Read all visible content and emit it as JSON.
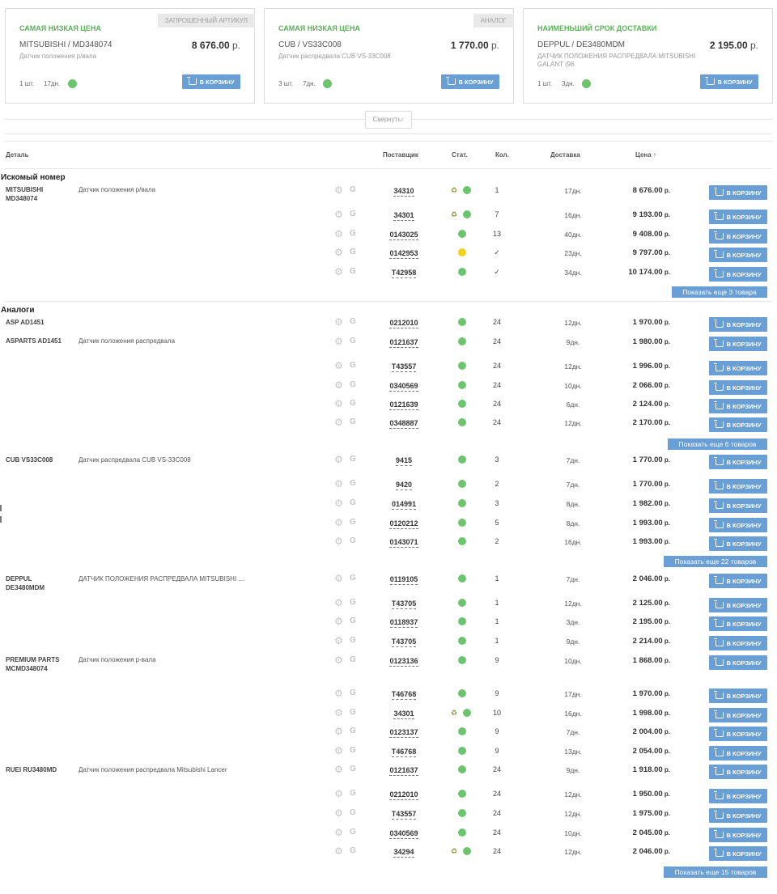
{
  "offers": [
    {
      "title": "Самая низкая цена",
      "badge": "Запрошенный артикул",
      "name": "MITSUBISHI / MD348074",
      "desc": "Датчик положения р/вала",
      "price": "8 676.00",
      "currency": "р.",
      "qty": "1 шт.",
      "days": "17дн.",
      "button": "В корзину"
    },
    {
      "title": "Самая низкая цена",
      "badge": "Аналог",
      "name": "CUB / VS33C008",
      "desc": "Датчик распредвала CUB VS-33C008",
      "price": "1 770.00",
      "currency": "р.",
      "qty": "3 шт.",
      "days": "7дн.",
      "button": "В корзину"
    },
    {
      "title": "Наименьший срок доставки",
      "badge": "",
      "name": "DEPPUL / DE3480MDM",
      "desc": "ДАТЧИК ПОЛОЖЕНИЯ РАСПРЕДВАЛА MITSUBISHI GALANT (96",
      "price": "2 195.00",
      "currency": "р.",
      "qty": "1 шт.",
      "days": "3дн.",
      "button": "В корзину"
    }
  ],
  "collapse_label": "Свернуть↑",
  "columns": {
    "detail": "Деталь",
    "supplier": "Поставщик",
    "status": "Стат.",
    "qty": "Кол.",
    "delivery": "Доставка",
    "price": "Цена ↑"
  },
  "sections": {
    "requested": "Искомый номер",
    "analogs": "Аналоги"
  },
  "currency": "р.",
  "buy_label": "В корзину",
  "groups": [
    {
      "brand": "MITSUBISHI MD348074",
      "desc": "Датчик положения р/вала",
      "more": "Показать еще 3 товара",
      "rows": [
        {
          "sup": "34310",
          "recycle": true,
          "status": "green",
          "qty": "1",
          "days": "17дн.",
          "price": "8 676.00"
        },
        {
          "sup": "34301",
          "recycle": true,
          "status": "green",
          "qty": "7",
          "days": "16дн.",
          "price": "9 193.00"
        },
        {
          "sup": "0143025",
          "recycle": false,
          "status": "green",
          "qty": "13",
          "days": "40дн.",
          "price": "9 408.00"
        },
        {
          "sup": "0142953",
          "recycle": false,
          "status": "yellow",
          "qty": "✓",
          "days": "23дн.",
          "price": "9 797.00"
        },
        {
          "sup": "T42958",
          "recycle": false,
          "status": "green",
          "qty": "✓",
          "days": "34дн.",
          "price": "10 174.00"
        }
      ]
    },
    {
      "brand": "ASP AD1451",
      "desc": "",
      "more": "",
      "rows": [
        {
          "sup": "0212010",
          "recycle": false,
          "status": "green",
          "qty": "24",
          "days": "12дн.",
          "price": "1 970.00"
        }
      ]
    },
    {
      "brand": "ASPARTS AD1451",
      "desc": "Датчик положения распредвала",
      "more": "Показать еще 6 товаров",
      "rows": [
        {
          "sup": "0121637",
          "recycle": false,
          "status": "green",
          "qty": "24",
          "days": "9дн.",
          "price": "1 980.00"
        },
        {
          "sup": "T43557",
          "recycle": false,
          "status": "green",
          "qty": "24",
          "days": "12дн.",
          "price": "1 996.00"
        },
        {
          "sup": "0340569",
          "recycle": false,
          "status": "green",
          "qty": "24",
          "days": "10дн.",
          "price": "2 066.00"
        },
        {
          "sup": "0121639",
          "recycle": false,
          "status": "green",
          "qty": "24",
          "days": "6дн.",
          "price": "2 124.00"
        },
        {
          "sup": "0348887",
          "recycle": false,
          "status": "green",
          "qty": "24",
          "days": "12дн.",
          "price": "2 170.00"
        }
      ]
    },
    {
      "brand": "CUB VS33C008",
      "desc": "Датчик распредвала CUB VS-33C008",
      "more": "Показать еще 22 товаров",
      "rows": [
        {
          "sup": "9415",
          "recycle": false,
          "status": "green",
          "qty": "3",
          "days": "7дн.",
          "price": "1 770.00"
        },
        {
          "sup": "9420",
          "recycle": false,
          "status": "green",
          "qty": "2",
          "days": "7дн.",
          "price": "1 770.00"
        },
        {
          "sup": "014991",
          "recycle": false,
          "status": "green",
          "qty": "3",
          "days": "8дн.",
          "price": "1 982.00"
        },
        {
          "sup": "0120212",
          "recycle": false,
          "status": "green",
          "qty": "5",
          "days": "8дн.",
          "price": "1 993.00"
        },
        {
          "sup": "0143071",
          "recycle": false,
          "status": "green",
          "qty": "2",
          "days": "16дн.",
          "price": "1 993.00"
        }
      ]
    },
    {
      "brand": "DEPPUL DE3480MDM",
      "desc": "ДАТЧИК ПОЛОЖЕНИЯ РАСПРЕДВАЛА MITSUBISHI ...",
      "more": "",
      "rows": [
        {
          "sup": "0119105",
          "recycle": false,
          "status": "green",
          "qty": "1",
          "days": "7дн.",
          "price": "2 046.00"
        },
        {
          "sup": "T43705",
          "recycle": false,
          "status": "green",
          "qty": "1",
          "days": "12дн.",
          "price": "2 125.00"
        },
        {
          "sup": "0118937",
          "recycle": false,
          "status": "green",
          "qty": "1",
          "days": "3дн.",
          "price": "2 195.00"
        },
        {
          "sup": "T43705",
          "recycle": false,
          "status": "green",
          "qty": "1",
          "days": "9дн.",
          "price": "2 214.00"
        }
      ]
    },
    {
      "brand": "PREMIUM PARTS MCMD348074",
      "desc": "Датчик положения р-вала",
      "more": "",
      "rows": [
        {
          "sup": "0123136",
          "recycle": false,
          "status": "green",
          "qty": "9",
          "days": "10дн.",
          "price": "1 868.00"
        },
        {
          "sup": "T46768",
          "recycle": false,
          "status": "green",
          "qty": "9",
          "days": "17дн.",
          "price": "1 970.00"
        },
        {
          "sup": "34301",
          "recycle": true,
          "status": "green",
          "qty": "10",
          "days": "16дн.",
          "price": "1 998.00"
        },
        {
          "sup": "0123137",
          "recycle": false,
          "status": "green",
          "qty": "9",
          "days": "7дн.",
          "price": "2 004.00"
        },
        {
          "sup": "T46768",
          "recycle": false,
          "status": "green",
          "qty": "9",
          "days": "13дн.",
          "price": "2 054.00"
        }
      ]
    },
    {
      "brand": "RUEI RU3480MD",
      "desc": "Датчик положения распредвала Mitsubishi Lancer",
      "more": "Показать еще 15 товаров",
      "rows": [
        {
          "sup": "0121637",
          "recycle": false,
          "status": "green",
          "qty": "24",
          "days": "9дн.",
          "price": "1 918.00"
        },
        {
          "sup": "0212010",
          "recycle": false,
          "status": "green",
          "qty": "24",
          "days": "12дн.",
          "price": "1 950.00"
        },
        {
          "sup": "T43557",
          "recycle": false,
          "status": "green",
          "qty": "24",
          "days": "12дн.",
          "price": "1 975.00"
        },
        {
          "sup": "0340569",
          "recycle": false,
          "status": "green",
          "qty": "24",
          "days": "10дн.",
          "price": "2 045.00"
        },
        {
          "sup": "34294",
          "recycle": true,
          "status": "green",
          "qty": "24",
          "days": "12дн.",
          "price": "2 046.00"
        }
      ]
    }
  ]
}
